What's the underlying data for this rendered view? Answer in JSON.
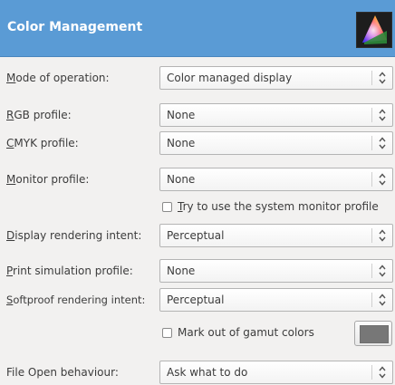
{
  "header": {
    "title": "Color Management",
    "icon": "color-management-icon"
  },
  "rows": {
    "mode": {
      "label_mnemonic": "M",
      "label_rest": "ode of operation:",
      "value": "Color managed display"
    },
    "rgb": {
      "label_mnemonic": "R",
      "label_rest": "GB profile:",
      "value": "None"
    },
    "cmyk": {
      "label_mnemonic": "C",
      "label_rest": "MYK profile:",
      "value": "None"
    },
    "monitor": {
      "label_mnemonic": "M",
      "label_rest": "onitor profile:",
      "value": "None"
    },
    "display_intent": {
      "label_mnemonic": "D",
      "label_rest": "isplay rendering intent:",
      "value": "Perceptual"
    },
    "print_sim": {
      "label_mnemonic": "P",
      "label_rest": "rint simulation profile:",
      "value": "None"
    },
    "softproof_intent": {
      "label_mnemonic": "S",
      "label_rest": "oftproof rendering intent:",
      "value": "Perceptual"
    },
    "file_open": {
      "label": "File Open behaviour:",
      "value": "Ask what to do"
    }
  },
  "checkboxes": {
    "system_monitor": {
      "mnemonic": "T",
      "rest": "ry to use the system monitor profile",
      "checked": false
    },
    "gamut": {
      "label": "Mark out of gamut colors",
      "checked": false
    }
  },
  "gamut_color": "#777777",
  "combo_icon": "updown-arrows-icon"
}
